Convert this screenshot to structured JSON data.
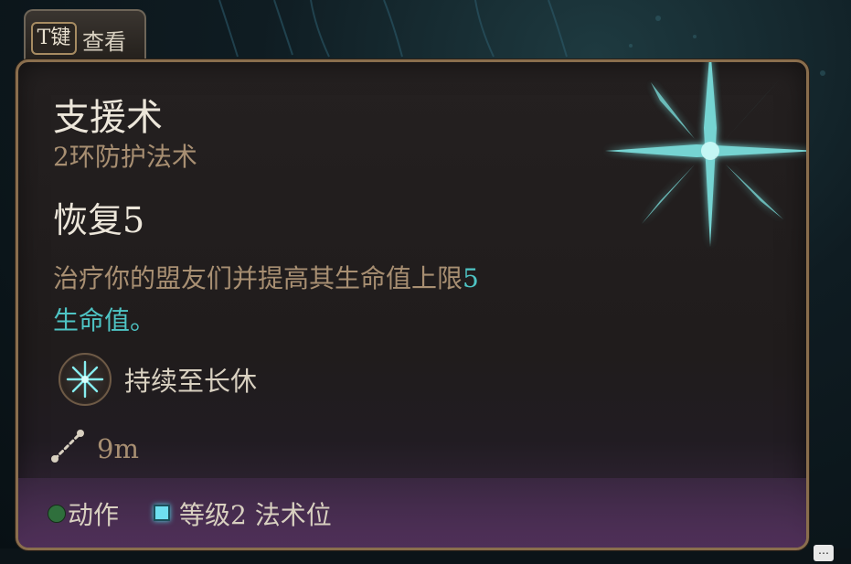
{
  "tab_hint": {
    "key": "T键",
    "label": "查看"
  },
  "spell": {
    "name": "支援术",
    "level_school": "2环防护法术",
    "effect": "恢复5",
    "description_main": "治疗你的盟友们并提高其生命值上限",
    "description_value": "5",
    "description_tail": "生命值。",
    "duration": "持续至长休",
    "range": "9m"
  },
  "costs": {
    "action_label": "动作",
    "slot_label": "等级2 法术位"
  },
  "icons": {
    "spell_art": "aid-spell-star-icon",
    "duration": "aid-spell-small-icon",
    "range": "range-icon",
    "action": "action-dot-icon",
    "spell_slot": "spell-slot-icon",
    "chat": "chat-bubble-icon"
  },
  "colors": {
    "border": "#8a6e4d",
    "title": "#ece6da",
    "subtitle": "#a88f72",
    "highlight": "#4ec4c4",
    "action": "#2f6f3c",
    "slot": "#6fe0f0"
  }
}
